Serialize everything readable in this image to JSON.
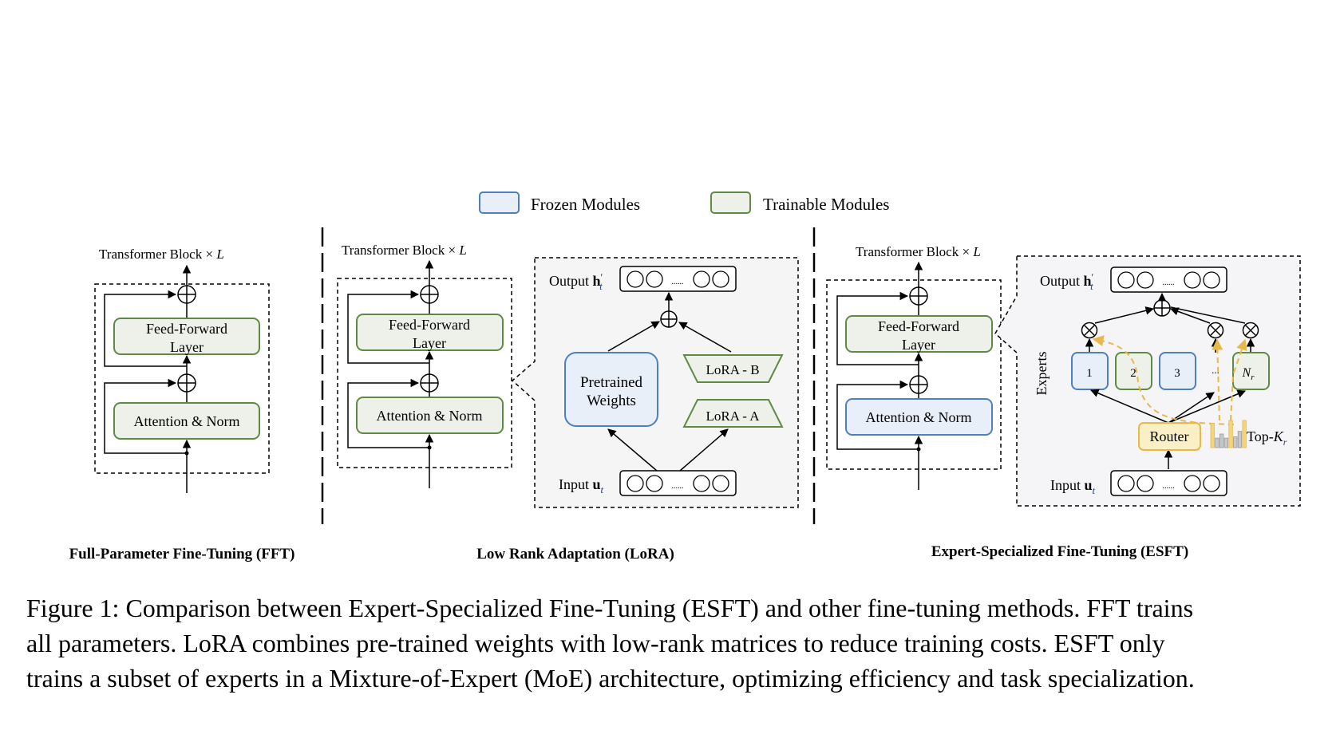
{
  "legend": {
    "frozen": {
      "label": "Frozen Modules",
      "fill": "#e9eff8",
      "stroke": "#4f7fbf"
    },
    "trainable": {
      "label": "Trainable Modules",
      "fill": "#eef1ea",
      "stroke": "#5f8a45"
    }
  },
  "colors": {
    "panel_bg": "#f5f5f5",
    "router_fill": "#fbefc6",
    "router_stroke": "#e8b94a",
    "topk_stroke": "#e8b94a",
    "bar_gray": "#c9c9c9"
  },
  "common": {
    "block_title": "Transformer Block × ",
    "block_title_var": "L",
    "ffn_line1": "Feed-Forward",
    "ffn_line2": "Layer",
    "attn": "Attention & Norm",
    "output_label": "Output ",
    "output_var": "h",
    "output_sub": "t",
    "input_label": "Input ",
    "input_var": "u",
    "input_sub": "t",
    "dots": "......"
  },
  "fft": {
    "title": "Full-Parameter Fine-Tuning (FFT)",
    "ffn_state": "trainable",
    "attn_state": "trainable"
  },
  "lora": {
    "title": "Low Rank Adaptation (LoRA)",
    "ffn_state": "trainable",
    "attn_state": "trainable",
    "pretrained_line1": "Pretrained",
    "pretrained_line2": "Weights",
    "lora_b": "LoRA - B",
    "lora_a": "LoRA - A"
  },
  "esft": {
    "title": "Expert-Specialized Fine-Tuning (ESFT)",
    "ffn_state": "trainable",
    "attn_state": "frozen",
    "experts_label": "Experts",
    "experts": [
      {
        "label": "1",
        "state": "frozen"
      },
      {
        "label": "2",
        "state": "trainable"
      },
      {
        "label": "3",
        "state": "frozen"
      },
      {
        "label": "...",
        "state": "none"
      },
      {
        "label": "N",
        "sub": "r",
        "state": "trainable"
      }
    ],
    "router": "Router",
    "topk_label": "Top-",
    "topk_var": "K",
    "topk_sub": "r",
    "topk_bars": [
      {
        "value": 0.9,
        "selected": true
      },
      {
        "value": 0.35,
        "selected": false
      },
      {
        "value": 0.5,
        "selected": false
      },
      {
        "value": 0.35,
        "selected": false
      },
      {
        "value": 1.0,
        "selected": true
      },
      {
        "value": 0.4,
        "selected": false
      },
      {
        "value": 0.6,
        "selected": false
      },
      {
        "value": 1.0,
        "selected": true
      }
    ]
  },
  "caption": {
    "line1": "Figure 1: Comparison between Expert-Specialized Fine-Tuning (ESFT) and other fine-tuning methods. FFT trains",
    "line2": "all parameters. LoRA combines pre-trained weights with low-rank matrices to reduce training costs. ESFT only",
    "line3": "trains a subset of experts in a Mixture-of-Expert (MoE) architecture, optimizing efficiency and task specialization."
  }
}
